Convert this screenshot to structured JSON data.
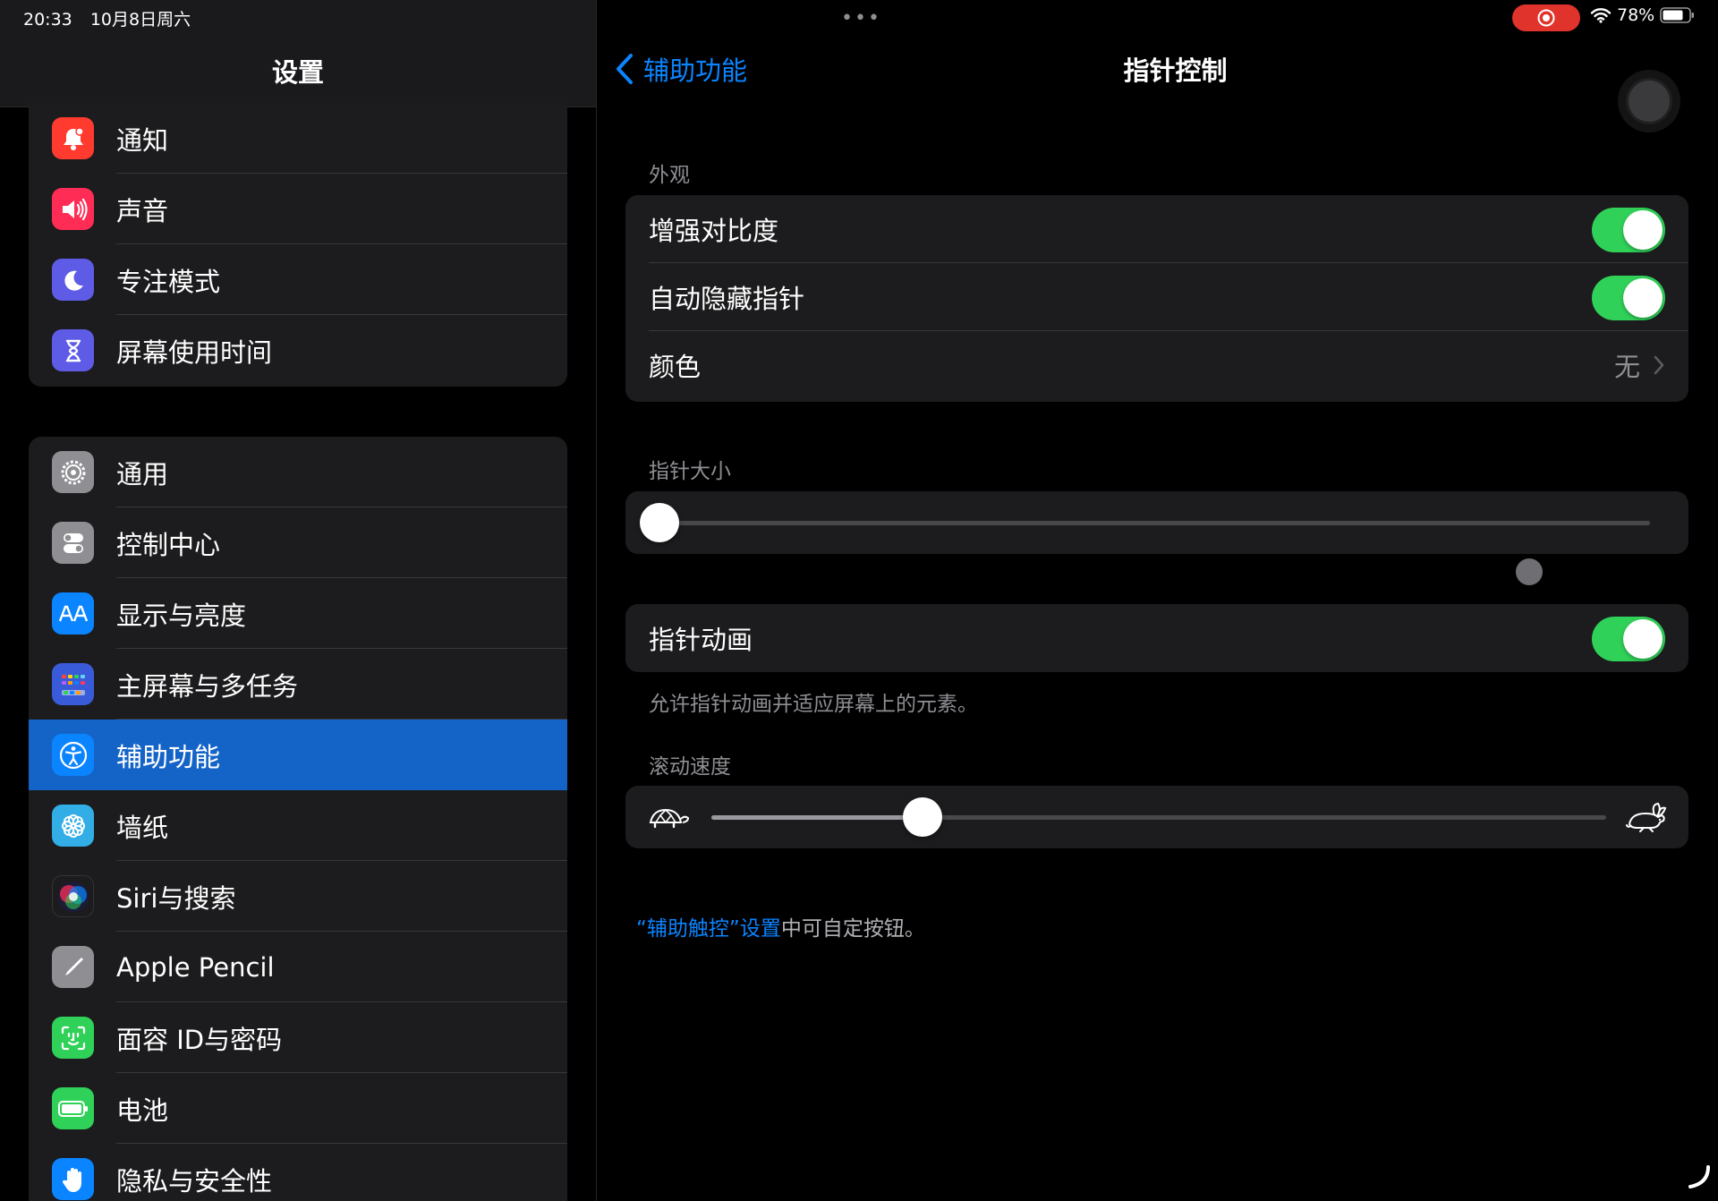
{
  "status_bar": {
    "time": "20:33",
    "date": "10月8日周六",
    "battery": "78%"
  },
  "sidebar": {
    "title": "设置",
    "group1": [
      {
        "label": "通知",
        "icon": "notifications-icon",
        "color": "#ff3b30"
      },
      {
        "label": "声音",
        "icon": "sounds-icon",
        "color": "#ff2d55"
      },
      {
        "label": "专注模式",
        "icon": "focus-moon-icon",
        "color": "#5e5ce6"
      },
      {
        "label": "屏幕使用时间",
        "icon": "screen-time-hourglass-icon",
        "color": "#5e5ce6"
      }
    ],
    "group2": [
      {
        "label": "通用",
        "icon": "general-gear-icon",
        "color": "#8e8e93"
      },
      {
        "label": "控制中心",
        "icon": "control-center-icon",
        "color": "#8e8e93"
      },
      {
        "label": "显示与亮度",
        "icon": "display-brightness-icon",
        "color": "#0a84ff"
      },
      {
        "label": "主屏幕与多任务",
        "icon": "home-screen-icon",
        "color": "#3a5bd9"
      },
      {
        "label": "辅助功能",
        "icon": "accessibility-icon",
        "color": "#0a84ff"
      },
      {
        "label": "墙纸",
        "icon": "wallpaper-icon",
        "color": "#32ade6"
      },
      {
        "label": "Siri与搜索",
        "icon": "siri-icon",
        "color": "#1c1c1e"
      },
      {
        "label": "Apple Pencil",
        "icon": "apple-pencil-icon",
        "color": "#8e8e93"
      },
      {
        "label": "面容 ID与密码",
        "icon": "face-id-icon",
        "color": "#30d158"
      },
      {
        "label": "电池",
        "icon": "battery-icon",
        "color": "#30d158"
      },
      {
        "label": "隐私与安全性",
        "icon": "privacy-hand-icon",
        "color": "#0a84ff"
      }
    ],
    "selected_index": 4
  },
  "detail": {
    "back_label": "辅助功能",
    "title": "指针控制",
    "appearance": {
      "header": "外观",
      "increase_contrast": {
        "label": "增强对比度",
        "on": true
      },
      "auto_hide": {
        "label": "自动隐藏指针",
        "on": true
      },
      "color": {
        "label": "颜色",
        "value": "无"
      }
    },
    "pointer_size": {
      "header": "指针大小",
      "value": 0.0
    },
    "pointer_animations": {
      "label": "指针动画",
      "on": true,
      "footer": "允许指针动画并适应屏幕上的元素。"
    },
    "scroll_speed": {
      "header": "滚动速度",
      "value": 0.236
    },
    "custom_footer": {
      "link": "“辅助触控”设置",
      "text": "中可自定按钮。"
    }
  },
  "colors": {
    "accent": "#0a84ff",
    "toggle_on": "#30d158",
    "selected_row": "#1464c8",
    "record": "#e0332c"
  }
}
